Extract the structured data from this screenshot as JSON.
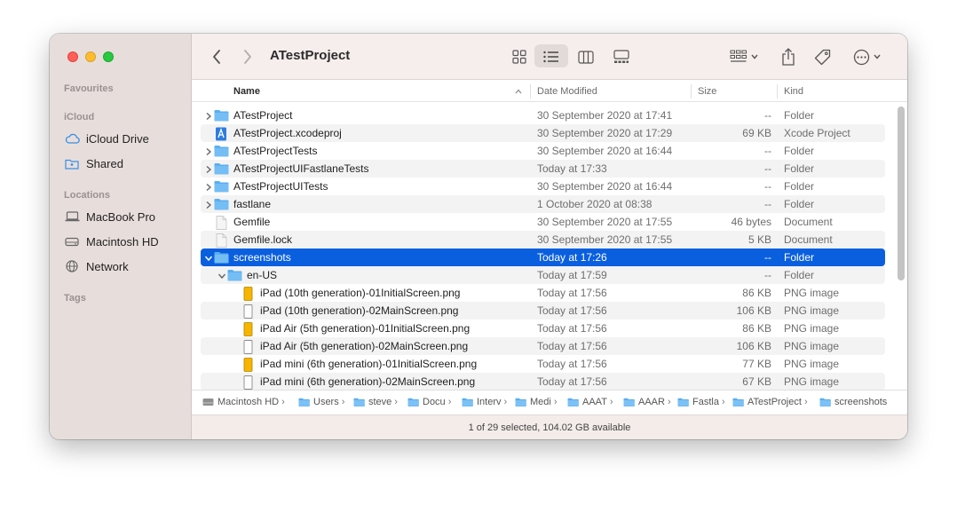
{
  "window": {
    "title": "ATestProject"
  },
  "sidebar": {
    "favourites_title": "Favourites",
    "icloud_title": "iCloud",
    "icloud_items": [
      {
        "label": "iCloud Drive",
        "icon": "cloud-icon"
      },
      {
        "label": "Shared",
        "icon": "shared-folder-icon"
      }
    ],
    "locations_title": "Locations",
    "locations_items": [
      {
        "label": "MacBook Pro",
        "icon": "laptop-icon"
      },
      {
        "label": "Macintosh HD",
        "icon": "disk-icon"
      },
      {
        "label": "Network",
        "icon": "globe-icon"
      }
    ],
    "tags_title": "Tags"
  },
  "columns": {
    "name": "Name",
    "date": "Date Modified",
    "size": "Size",
    "kind": "Kind"
  },
  "files": [
    {
      "name": "ATestProject",
      "date": "30 September 2020 at 17:41",
      "size": "--",
      "kind": "Folder",
      "type": "folder",
      "disclosure": "collapsed",
      "level": 0
    },
    {
      "name": "ATestProject.xcodeproj",
      "date": "30 September 2020 at 17:29",
      "size": "69 KB",
      "kind": "Xcode Project",
      "type": "xcodeproj",
      "disclosure": "none",
      "level": 0
    },
    {
      "name": "ATestProjectTests",
      "date": "30 September 2020 at 16:44",
      "size": "--",
      "kind": "Folder",
      "type": "folder",
      "disclosure": "collapsed",
      "level": 0
    },
    {
      "name": "ATestProjectUIFastlaneTests",
      "date": "Today at 17:33",
      "size": "--",
      "kind": "Folder",
      "type": "folder",
      "disclosure": "collapsed",
      "level": 0
    },
    {
      "name": "ATestProjectUITests",
      "date": "30 September 2020 at 16:44",
      "size": "--",
      "kind": "Folder",
      "type": "folder",
      "disclosure": "collapsed",
      "level": 0
    },
    {
      "name": "fastlane",
      "date": "1 October 2020 at 08:38",
      "size": "--",
      "kind": "Folder",
      "type": "folder",
      "disclosure": "collapsed",
      "level": 0
    },
    {
      "name": "Gemfile",
      "date": "30 September 2020 at 17:55",
      "size": "46 bytes",
      "kind": "Document",
      "type": "document",
      "disclosure": "none",
      "level": 0
    },
    {
      "name": "Gemfile.lock",
      "date": "30 September 2020 at 17:55",
      "size": "5 KB",
      "kind": "Document",
      "type": "document",
      "disclosure": "none",
      "level": 0
    },
    {
      "name": "screenshots",
      "date": "Today at 17:26",
      "size": "--",
      "kind": "Folder",
      "type": "folder",
      "disclosure": "expanded",
      "level": 0,
      "selected": true
    },
    {
      "name": "en-US",
      "date": "Today at 17:59",
      "size": "--",
      "kind": "Folder",
      "type": "folder",
      "disclosure": "expanded",
      "level": 1
    },
    {
      "name": "iPad (10th generation)-01InitialScreen.png",
      "date": "Today at 17:56",
      "size": "86 KB",
      "kind": "PNG image",
      "type": "png-yellow",
      "disclosure": "none",
      "level": 2
    },
    {
      "name": "iPad (10th generation)-02MainScreen.png",
      "date": "Today at 17:56",
      "size": "106 KB",
      "kind": "PNG image",
      "type": "png-white",
      "disclosure": "none",
      "level": 2
    },
    {
      "name": "iPad Air (5th generation)-01InitialScreen.png",
      "date": "Today at 17:56",
      "size": "86 KB",
      "kind": "PNG image",
      "type": "png-yellow",
      "disclosure": "none",
      "level": 2
    },
    {
      "name": "iPad Air (5th generation)-02MainScreen.png",
      "date": "Today at 17:56",
      "size": "106 KB",
      "kind": "PNG image",
      "type": "png-white",
      "disclosure": "none",
      "level": 2
    },
    {
      "name": "iPad mini (6th generation)-01InitialScreen.png",
      "date": "Today at 17:56",
      "size": "77 KB",
      "kind": "PNG image",
      "type": "png-yellow",
      "disclosure": "none",
      "level": 2
    },
    {
      "name": "iPad mini (6th generation)-02MainScreen.png",
      "date": "Today at 17:56",
      "size": "67 KB",
      "kind": "PNG image",
      "type": "png-white",
      "disclosure": "none",
      "level": 2
    }
  ],
  "path": [
    {
      "label": "Macintosh HD",
      "icon": "disk-icon"
    },
    {
      "label": "Users",
      "icon": "folder-icon"
    },
    {
      "label": "steve",
      "icon": "home-folder-icon"
    },
    {
      "label": "Docu",
      "icon": "folder-icon"
    },
    {
      "label": "Interv",
      "icon": "folder-icon"
    },
    {
      "label": "Medi",
      "icon": "folder-icon"
    },
    {
      "label": "AAAT",
      "icon": "folder-icon"
    },
    {
      "label": "AAAR",
      "icon": "folder-icon"
    },
    {
      "label": "Fastla",
      "icon": "folder-icon"
    },
    {
      "label": "ATestProject",
      "icon": "folder-icon"
    },
    {
      "label": "screenshots",
      "icon": "folder-icon"
    }
  ],
  "status": {
    "text": "1 of 29 selected, 104.02 GB available"
  },
  "colors": {
    "selection": "#0a5fdf",
    "folder": "#5aaef0",
    "sidebar_bg": "#e7dedc"
  }
}
